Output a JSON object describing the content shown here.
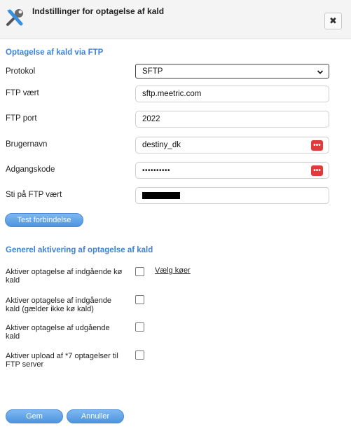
{
  "dialog": {
    "title": "Indstillinger for optagelse af kald",
    "close_label": "✖",
    "icon": "tools-icon"
  },
  "ftp_section": {
    "title": "Optagelse af kald via FTP",
    "protocol": {
      "label": "Protokol",
      "value": "SFTP"
    },
    "host": {
      "label": "FTP vært",
      "value": "sftp.meetric.com"
    },
    "port": {
      "label": "FTP port",
      "value": "2022"
    },
    "username": {
      "label": "Brugernavn",
      "value": "destiny_dk"
    },
    "password": {
      "label": "Adgangskode",
      "value": "••••••••••"
    },
    "path": {
      "label": "Sti på FTP vært"
    },
    "test_button": "Test forbindelse",
    "dots_glyph": "•••"
  },
  "activation_section": {
    "title": "Generel aktivering af optagelse af kald",
    "options": [
      {
        "label": "Aktiver optagelse af indgående kø kald",
        "checked": false
      },
      {
        "label": "Aktiver optagelse af indgående kald (gælder ikke kø kald)",
        "checked": false
      },
      {
        "label": "Aktiver optagelse af udgående kald",
        "checked": false
      },
      {
        "label": "Aktiver upload af *7 optagelser til FTP server",
        "checked": false
      }
    ],
    "select_queues_link": "Vælg køer"
  },
  "footer": {
    "save_label": "Gem",
    "cancel_label": "Annuller"
  },
  "colors": {
    "accent": "#3f82d4",
    "button": "#5b9de5",
    "danger": "#e03a3a"
  }
}
